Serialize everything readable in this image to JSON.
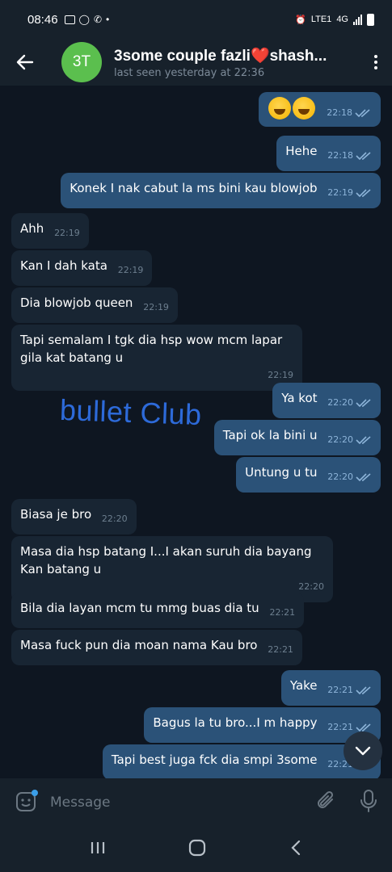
{
  "status": {
    "time": "08:46",
    "network": "LTE1",
    "net_gen": "4G"
  },
  "header": {
    "avatar_initials": "3T",
    "title": "3some couple fazli❤️shash...",
    "subtitle": "last seen yesterday at 22:36"
  },
  "watermark": "bullet Club",
  "messages": [
    {
      "dir": "out",
      "text": "",
      "emoji": 2,
      "time": "22:18"
    },
    {
      "dir": "out",
      "text": "Hehe",
      "time": "22:18"
    },
    {
      "dir": "out",
      "text": "Konek I nak cabut la ms bini kau blowjob",
      "time": "22:19"
    },
    {
      "dir": "in",
      "text": "Ahh",
      "time": "22:19"
    },
    {
      "dir": "in",
      "text": "Kan I dah kata",
      "time": "22:19"
    },
    {
      "dir": "in",
      "text": "Dia blowjob queen",
      "time": "22:19"
    },
    {
      "dir": "in",
      "text": "Tapi semalam I tgk dia hsp wow mcm lapar gila kat batang u",
      "time": "22:19"
    },
    {
      "dir": "out",
      "text": "Ya kot",
      "time": "22:20"
    },
    {
      "dir": "out",
      "text": "Tapi ok la bini u",
      "time": "22:20"
    },
    {
      "dir": "out",
      "text": "Untung u tu",
      "time": "22:20"
    },
    {
      "dir": "in",
      "text": "Biasa je bro",
      "time": "22:20"
    },
    {
      "dir": "in",
      "text": "Masa dia hsp batang I...I akan suruh dia bayang Kan batang u",
      "time": "22:20"
    },
    {
      "dir": "in",
      "text": "Bila dia layan mcm tu mmg buas dia tu",
      "time": "22:21"
    },
    {
      "dir": "in",
      "text": "Masa fuck pun dia moan nama Kau bro",
      "time": "22:21"
    },
    {
      "dir": "out",
      "text": "Yake",
      "time": "22:21"
    },
    {
      "dir": "out",
      "text": "Bagus la tu bro...I m happy",
      "time": "22:21"
    },
    {
      "dir": "out",
      "text": "Tapi best juga fck dia smpi 3some",
      "time": "22:21"
    }
  ],
  "composer": {
    "placeholder": "Message"
  },
  "colors": {
    "bg": "#0e1621",
    "bar": "#17212b",
    "out_bubble": "#2b5278",
    "in_bubble": "#182533",
    "avatar": "#5bbf4e",
    "watermark": "#2d6ad9"
  },
  "icons": [
    "back-arrow-icon",
    "more-vert-icon",
    "sticker-icon",
    "attach-icon",
    "mic-icon",
    "chevron-down-icon",
    "nav-recents-icon",
    "nav-home-icon",
    "nav-back-icon"
  ]
}
